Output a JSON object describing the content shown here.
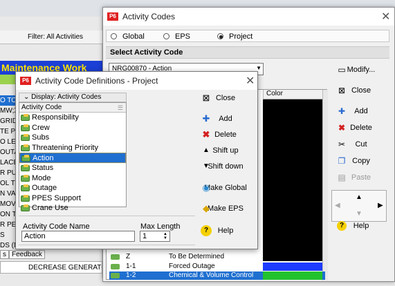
{
  "background_app": {
    "filter_label": "Filter: All Activities",
    "banner": "Maintenance Work",
    "row_fragments": [
      "O TO",
      "MW;X",
      "GRID",
      "TE PU",
      "O LES",
      "OUTA",
      "LACE",
      "R PU",
      "OL TO",
      "N VA",
      "MOVA",
      "ON T",
      "R PE",
      "S",
      "DS (N"
    ],
    "tab_left": "s",
    "tab_feedback": "Feedback",
    "decrease_text": "DECREASE GENERATOR LO"
  },
  "activity_codes": {
    "title": "Activity Codes",
    "radios": [
      {
        "label": "Global",
        "checked": false
      },
      {
        "label": "EPS",
        "checked": false
      },
      {
        "label": "Project",
        "checked": true
      }
    ],
    "select_label": "Select Activity Code",
    "combo_value": "NRG00870 - Action",
    "color_header": "Color",
    "buttons": {
      "modify": "Modify...",
      "close": "Close",
      "add": "Add",
      "delete": "Delete",
      "cut": "Cut",
      "copy": "Copy",
      "paste": "Paste",
      "help": "Help"
    },
    "rows": [
      {
        "code": "Z",
        "desc": "To Be Determined",
        "color": "#000000"
      },
      {
        "code": "1-1",
        "desc": "Forced Outage",
        "color": "#1e3cff"
      },
      {
        "code": "1-2",
        "desc": "Chemical & Volume Control",
        "color": "#22c22e"
      }
    ]
  },
  "definitions": {
    "title": "Activity Code Definitions - Project",
    "display_label": "Display: Activity Codes",
    "column_header": "Activity Code",
    "items": [
      {
        "label": "Responsibility",
        "selected": false
      },
      {
        "label": "Crew",
        "selected": false
      },
      {
        "label": "Subs",
        "selected": false
      },
      {
        "label": "Threatening Priority",
        "selected": false
      },
      {
        "label": "Action",
        "selected": true
      },
      {
        "label": "Status",
        "selected": false
      },
      {
        "label": "Mode",
        "selected": false
      },
      {
        "label": "Outage",
        "selected": false
      },
      {
        "label": "PPES Support",
        "selected": false
      },
      {
        "label": "Crane Use",
        "selected": false
      }
    ],
    "buttons": {
      "close": "Close",
      "add": "Add",
      "delete": "Delete",
      "shift_up": "Shift up",
      "shift_down": "Shift down",
      "make_global": "Make Global",
      "make_eps": "Make EPS",
      "help": "Help"
    },
    "name_label": "Activity Code Name",
    "name_value": "Action",
    "max_label": "Max Length",
    "max_value": "1"
  }
}
